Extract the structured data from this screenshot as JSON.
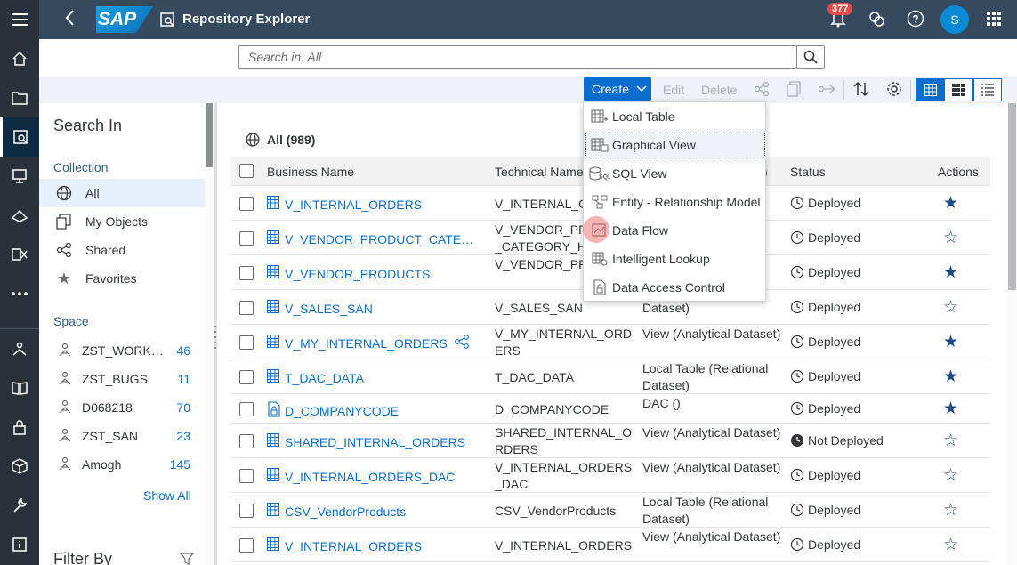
{
  "shell": {
    "title": "Repository Explorer",
    "logo_text": "SAP",
    "notifications_count": "377",
    "avatar_initial": "S"
  },
  "rail": {
    "items": [
      "home-icon",
      "folder-icon",
      "repository-explorer-icon",
      "presentation-icon",
      "business-builder-icon",
      "data-integration-icon",
      "more-icon",
      "space-management-icon",
      "book-icon",
      "lock-icon",
      "package-icon",
      "wrench-icon",
      "info-icon"
    ],
    "active_index": 2
  },
  "search": {
    "placeholder": "Search in: All"
  },
  "toolbar": {
    "create_label": "Create",
    "edit_label": "Edit",
    "delete_label": "Delete"
  },
  "left_panel": {
    "title": "Search In",
    "collection_heading": "Collection",
    "collection": [
      {
        "label": "All",
        "icon": "globe-icon",
        "selected": true
      },
      {
        "label": "My Objects",
        "icon": "my-objects-icon",
        "selected": false
      },
      {
        "label": "Shared",
        "icon": "share-icon",
        "selected": false
      },
      {
        "label": "Favorites",
        "icon": "star-icon",
        "selected": false
      }
    ],
    "space_heading": "Space",
    "spaces": [
      {
        "name": "ZST_WORK…",
        "count": "46"
      },
      {
        "name": "ZST_BUGS",
        "count": "11"
      },
      {
        "name": "D068218",
        "count": "70"
      },
      {
        "name": "ZST_SAN",
        "count": "23"
      },
      {
        "name": "Amogh",
        "count": "145"
      }
    ],
    "show_all": "Show All",
    "filter_by": "Filter By"
  },
  "main": {
    "all_label": "All (989)",
    "columns": {
      "business_name": "Business Name",
      "technical_name": "Technical Name",
      "semantic_usage": ")",
      "status": "Status",
      "actions": "Actions"
    },
    "rows": [
      {
        "business": "V_INTERNAL_ORDERS",
        "technical": "V_INTERNAL_O",
        "type": "",
        "status": "Deployed",
        "fav": true,
        "shared": false
      },
      {
        "business": "V_VENDOR_PRODUCT_CATE…",
        "technical": "V_VENDOR_PR _CATEGORY_H",
        "type": "",
        "status": "Deployed",
        "fav": false,
        "shared": false
      },
      {
        "business": "V_VENDOR_PRODUCTS",
        "technical": "V_VENDOR_PR S",
        "type": "",
        "status": "Deployed",
        "fav": true,
        "shared": false
      },
      {
        "business": "V_SALES_SAN",
        "technical": "V_SALES_SAN",
        "type": "Dataset)",
        "status": "Deployed",
        "fav": false,
        "shared": false
      },
      {
        "business": "V_MY_INTERNAL_ORDERS",
        "technical": "V_MY_INTERNAL_ORD ERS",
        "type": "View (Analytical Dataset)",
        "status": "Deployed",
        "fav": true,
        "shared": true
      },
      {
        "business": "T_DAC_DATA",
        "technical": "T_DAC_DATA",
        "type": "Local Table (Relational Dataset)",
        "status": "Deployed",
        "fav": true,
        "shared": false
      },
      {
        "business": "D_COMPANYCODE",
        "technical": "D_COMPANYCODE",
        "type": "DAC ()",
        "status": "Deployed",
        "fav": true,
        "shared": false
      },
      {
        "business": "SHARED_INTERNAL_ORDERS",
        "technical": "SHARED_INTERNAL_O RDERS",
        "type": "View (Analytical Dataset)",
        "status": "Not Deployed",
        "fav": false,
        "shared": false
      },
      {
        "business": "V_INTERNAL_ORDERS_DAC",
        "technical": "V_INTERNAL_ORDERS _DAC",
        "type": "View (Analytical Dataset)",
        "status": "Deployed",
        "fav": false,
        "shared": false
      },
      {
        "business": "CSV_VendorProducts",
        "technical": "CSV_VendorProducts",
        "type": "Local Table (Relational Dataset)",
        "status": "Deployed",
        "fav": false,
        "shared": false
      },
      {
        "business": "V_INTERNAL_ORDERS",
        "technical": "V_INTERNAL_ORDERS",
        "type": "View (Analytical Dataset)",
        "status": "Deployed",
        "fav": false,
        "shared": false
      }
    ]
  },
  "create_menu": {
    "items": [
      {
        "label": "Local Table",
        "icon": "local-table-icon"
      },
      {
        "label": "Graphical View",
        "icon": "graphical-view-icon"
      },
      {
        "label": "SQL View",
        "icon": "sql-view-icon"
      },
      {
        "label": "Entity - Relationship Model",
        "icon": "er-model-icon"
      },
      {
        "label": "Data Flow",
        "icon": "data-flow-icon"
      },
      {
        "label": "Intelligent Lookup",
        "icon": "intelligent-lookup-icon"
      },
      {
        "label": "Data Access Control",
        "icon": "data-access-control-icon"
      }
    ]
  },
  "colors": {
    "shell": "#354a5f",
    "rail": "#29313a",
    "accent": "#0a6ed1",
    "favorite": "#1f4a80"
  }
}
